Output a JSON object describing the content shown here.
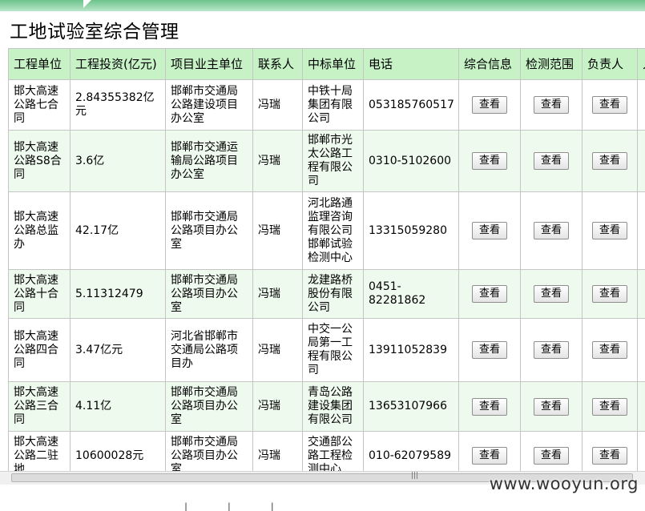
{
  "page": {
    "title": "工地试验室综合管理",
    "button_label": "查看",
    "watermark": "www.wooyun.org"
  },
  "table": {
    "headers": [
      "工程单位",
      "工程投资(亿元)",
      "项目业主单位",
      "联系人",
      "中标单位",
      "电话",
      "综合信息",
      "检测范围",
      "负责人",
      "人"
    ],
    "rows": [
      {
        "unit": "邯大高速公路七合同",
        "investment": "2.84355382亿元",
        "owner": "邯郸市交通局公路建设项目办公室",
        "contact": "冯瑞",
        "bidder": "中铁十局集团有限公司",
        "phone": "053185760517"
      },
      {
        "unit": "邯大高速公路S8合同",
        "investment": "3.6亿",
        "owner": "邯郸市交通运输局公路项目办公室",
        "contact": "冯瑞",
        "bidder": "邯郸市光太公路工程有限公司",
        "phone": "0310-5102600"
      },
      {
        "unit": "邯大高速公路总监办",
        "investment": "42.17亿",
        "owner": "邯郸市交通局公路项目办公室",
        "contact": "冯瑞",
        "bidder": "河北路通监理咨询有限公司邯郸试验检测中心",
        "phone": "13315059280"
      },
      {
        "unit": "邯大高速公路十合同",
        "investment": "5.11312479",
        "owner": "邯郸市交通局公路项目办公室",
        "contact": "冯瑞",
        "bidder": "龙建路桥股份有限公司",
        "phone": "0451-82281862"
      },
      {
        "unit": "邯大高速公路四合同",
        "investment": "3.47亿元",
        "owner": "河北省邯郸市交通局公路项目办",
        "contact": "冯瑞",
        "bidder": "中交一公局第一工程有限公司",
        "phone": "13911052839"
      },
      {
        "unit": "邯大高速公路三合同",
        "investment": "4.11亿",
        "owner": "邯郸市交通局公路项目办公室",
        "contact": "冯瑞",
        "bidder": "青岛公路建设集团有限公司",
        "phone": "13653107966"
      },
      {
        "unit": "邯大高速公路二驻地",
        "investment": "10600028元",
        "owner": "邯郸市交通局公路项目办公室",
        "contact": "冯瑞",
        "bidder": "交通部公路工程检测中心",
        "phone": "010-62079589"
      }
    ]
  }
}
